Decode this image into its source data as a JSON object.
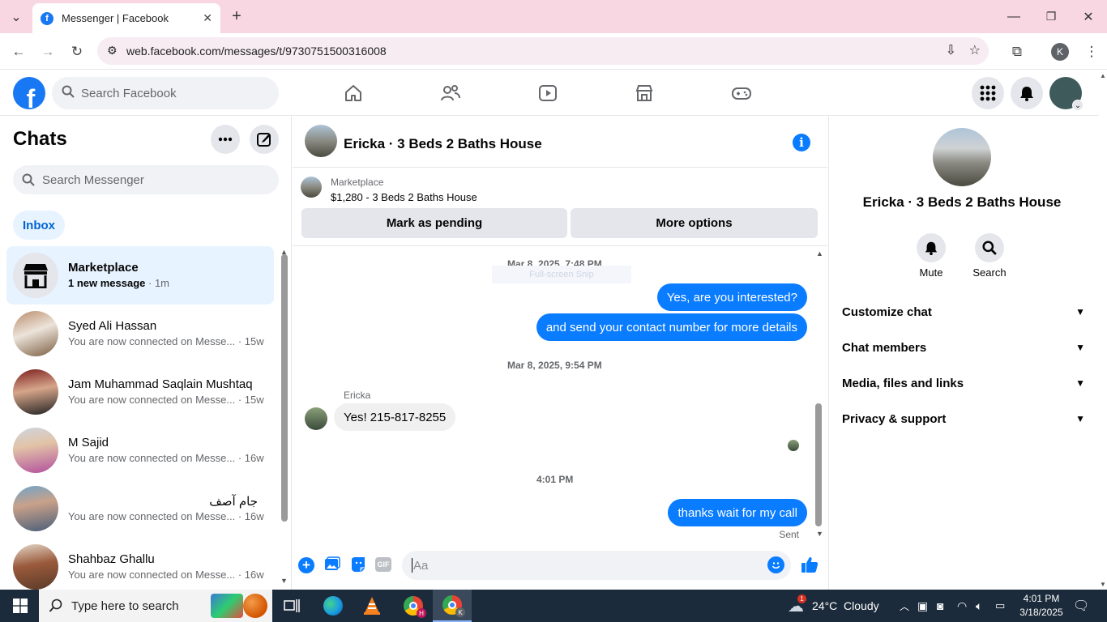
{
  "browser": {
    "tab_title": "Messenger | Facebook",
    "url": "web.facebook.com/messages/t/9730751500316008",
    "profile_initial": "K"
  },
  "facebook": {
    "search_placeholder": "Search Facebook"
  },
  "chats": {
    "title": "Chats",
    "search_placeholder": "Search Messenger",
    "inbox_label": "Inbox",
    "items": [
      {
        "name": "Marketplace",
        "preview": "1 new message",
        "time": " · 1m",
        "unread": true
      },
      {
        "name": "Syed Ali Hassan",
        "preview": "You are now connected on Messe...",
        "time": " · 15w"
      },
      {
        "name": "Jam Muhammad Saqlain Mushtaq",
        "preview": "You are now connected on Messe...",
        "time": " · 15w"
      },
      {
        "name": "M Sajid",
        "preview": "You are now connected on Messe...",
        "time": " · 16w"
      },
      {
        "name": "جام آصف",
        "preview": "You are now connected on Messe...",
        "time": " · 16w"
      },
      {
        "name": "Shahbaz Ghallu",
        "preview": "You are now connected on Messe...",
        "time": " · 16w"
      }
    ]
  },
  "conversation": {
    "title": "Ericka · 3 Beds 2 Baths House",
    "marketplace_label": "Marketplace",
    "listing": "$1,280 - 3 Beds 2 Baths House",
    "mark_pending": "Mark as pending",
    "more_options": "More options",
    "overlay_text": "Full-screen Snip",
    "timestamp1": "Mar 8, 2025, 7:48 PM",
    "msg1": "Yes, are you interested?",
    "msg2": "and send your contact number for more details",
    "timestamp2": "Mar 8, 2025, 9:54 PM",
    "sender": "Ericka",
    "msg3": "Yes! 215-817-8255",
    "timestamp3": "4:01 PM",
    "msg4": "thanks wait for my call",
    "status": "Sent",
    "composer_placeholder": "Aa",
    "gif_label": "GIF"
  },
  "details": {
    "name": "Ericka · 3 Beds 2 Baths House",
    "mute_label": "Mute",
    "search_label": "Search",
    "sections": [
      "Customize chat",
      "Chat members",
      "Media, files and links",
      "Privacy & support"
    ]
  },
  "taskbar": {
    "search_placeholder": "Type here to search",
    "weather": "24°C  Cloudy",
    "weather_badge": "1",
    "time": "4:01 PM",
    "date": "3/18/2025"
  },
  "colors": {
    "facebook_blue": "#1877f2",
    "messenger_blue": "#0a7cff",
    "tab_strip": "#f8d7e3",
    "taskbar": "#1c2b3b"
  }
}
